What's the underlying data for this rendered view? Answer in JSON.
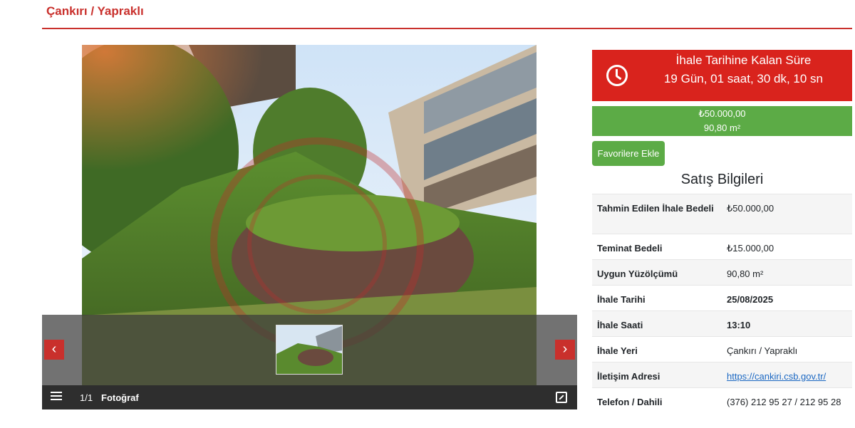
{
  "header": {
    "title": "Çankırı / Yapraklı"
  },
  "gallery": {
    "counter": "1/1",
    "label": "Fotoğraf",
    "prev_label": "‹",
    "next_label": "›"
  },
  "countdown": {
    "title": "İhale Tarihine Kalan Süre",
    "value": "19 Gün, 01 saat, 30 dk, 10 sn"
  },
  "price": {
    "amount": "₺50.000,00",
    "area": "90,80 m²"
  },
  "favorite_button": "Favorilere Ekle",
  "section_title": "Satış Bilgileri",
  "info_rows": [
    {
      "label": "Tahmin Edilen İhale Bedeli",
      "value": "₺50.000,00"
    },
    {
      "label": "Teminat Bedeli",
      "value": "₺15.000,00"
    },
    {
      "label": "Uygun Yüzölçümü",
      "value": "90,80 m²"
    },
    {
      "label": "İhale Tarihi",
      "value": "25/08/2025"
    },
    {
      "label": "İhale Saati",
      "value": "13:10"
    },
    {
      "label": "İhale Yeri",
      "value": "Çankırı / Yapraklı"
    },
    {
      "label": "İletişim Adresi",
      "value": "https://cankiri.csb.gov.tr/"
    },
    {
      "label": "Telefon / Dahili",
      "value": "(376) 212 95 27 / 212 95 28"
    }
  ]
}
